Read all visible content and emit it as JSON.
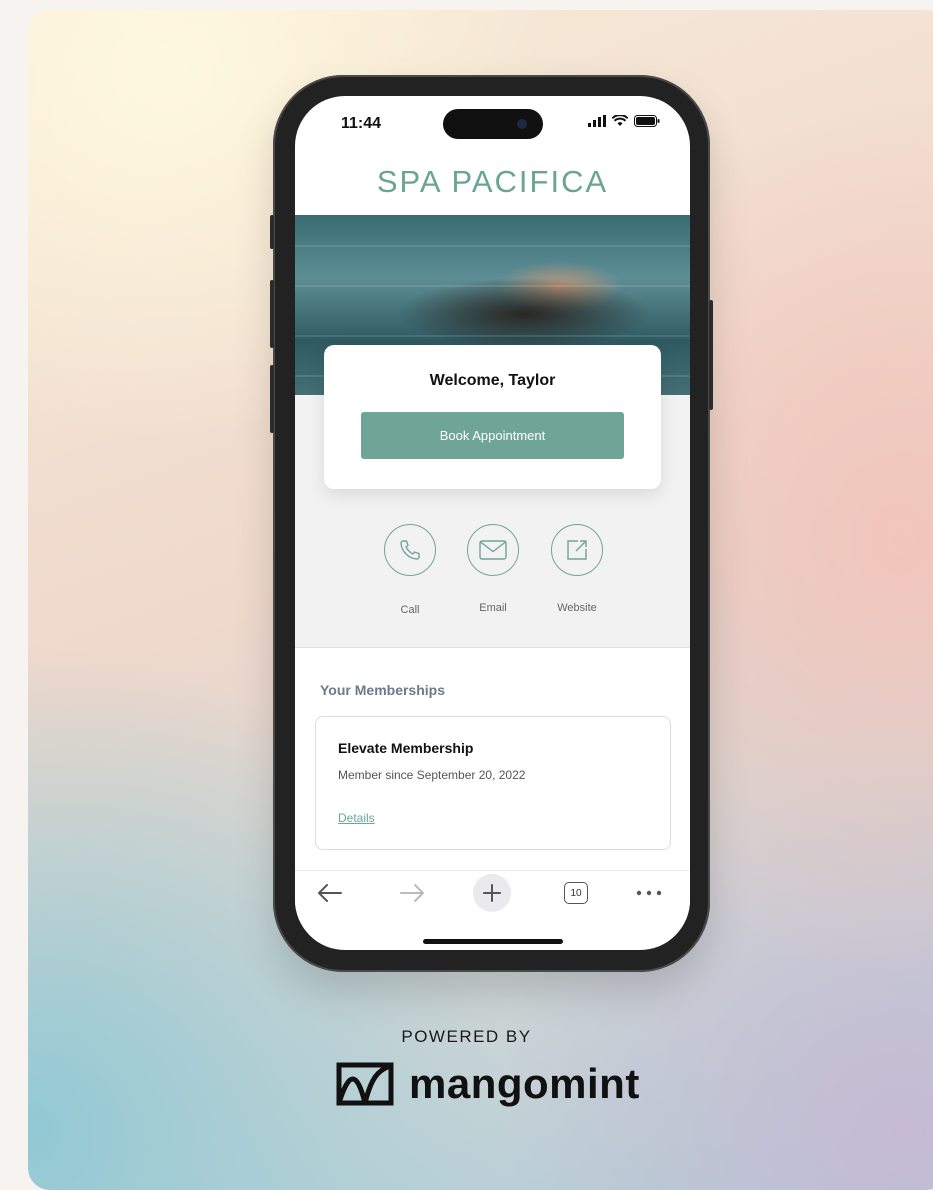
{
  "status_bar": {
    "time": "11:44"
  },
  "brand": {
    "name": "SPA PACIFICA"
  },
  "welcome": {
    "title": "Welcome, Taylor",
    "book_label": "Book Appointment"
  },
  "actions": [
    {
      "label": "Call",
      "icon": "phone-icon"
    },
    {
      "label": "Email",
      "icon": "mail-icon"
    },
    {
      "label": "Website",
      "icon": "external-link-icon"
    }
  ],
  "memberships": {
    "heading": "Your Memberships",
    "items": [
      {
        "title": "Elevate Membership",
        "since": "Member since September 20, 2022",
        "link": "Details"
      }
    ]
  },
  "browser_toolbar": {
    "tab_count": "10"
  },
  "footer": {
    "powered_by": "POWERED BY",
    "logo_text": "mangomint"
  },
  "colors": {
    "accent": "#6fa597",
    "heading": "#6c7a8e"
  }
}
